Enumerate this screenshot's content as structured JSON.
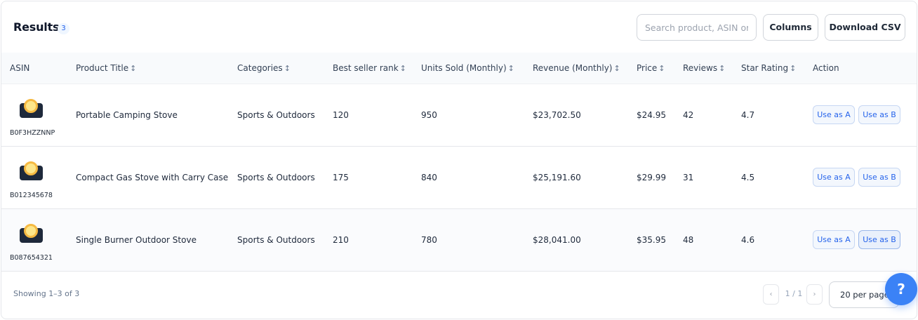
{
  "header": {
    "title": "Results:",
    "count": "3",
    "search_placeholder": "Search product, ASIN or brand",
    "columns_label": "Columns",
    "download_label": "Download CSV"
  },
  "table": {
    "columns": [
      {
        "label": "ASIN",
        "sortable": false
      },
      {
        "label": "Product Title",
        "sortable": true
      },
      {
        "label": "Categories",
        "sortable": true
      },
      {
        "label": "Best seller rank",
        "sortable": true
      },
      {
        "label": "Units Sold (Monthly)",
        "sortable": true
      },
      {
        "label": "Revenue (Monthly)",
        "sortable": true
      },
      {
        "label": "Price",
        "sortable": true
      },
      {
        "label": "Reviews",
        "sortable": true
      },
      {
        "label": "Star Rating",
        "sortable": true
      },
      {
        "label": "Action",
        "sortable": false
      }
    ],
    "sort_icon": "↕",
    "rows": [
      {
        "asin": "B0F3HZZNNP",
        "title": "Portable Camping Stove",
        "category": "Sports & Outdoors",
        "rank": "120",
        "units": "950",
        "revenue": "$23,702.50",
        "price": "$24.95",
        "reviews": "42",
        "rating": "4.7",
        "use_a": "Use as A",
        "use_b": "Use as B"
      },
      {
        "asin": "B012345678",
        "title": "Compact Gas Stove with Carry Case",
        "category": "Sports & Outdoors",
        "rank": "175",
        "units": "840",
        "revenue": "$25,191.60",
        "price": "$29.99",
        "reviews": "31",
        "rating": "4.5",
        "use_a": "Use as A",
        "use_b": "Use as B"
      },
      {
        "asin": "B087654321",
        "title": "Single Burner Outdoor Stove",
        "category": "Sports & Outdoors",
        "rank": "210",
        "units": "780",
        "revenue": "$28,041.00",
        "price": "$35.95",
        "reviews": "48",
        "rating": "4.6",
        "use_a": "Use as A",
        "use_b": "Use as B"
      }
    ]
  },
  "footer": {
    "showing": "Showing 1–3 of 3",
    "prev_icon": "‹",
    "page_info": "1 / 1",
    "next_icon": "›",
    "per_page": "20 per page",
    "help_label": "?"
  },
  "colors": {
    "accent": "#3b82f6",
    "link_blue": "#2563eb",
    "header_bg": "#f8fafc"
  }
}
